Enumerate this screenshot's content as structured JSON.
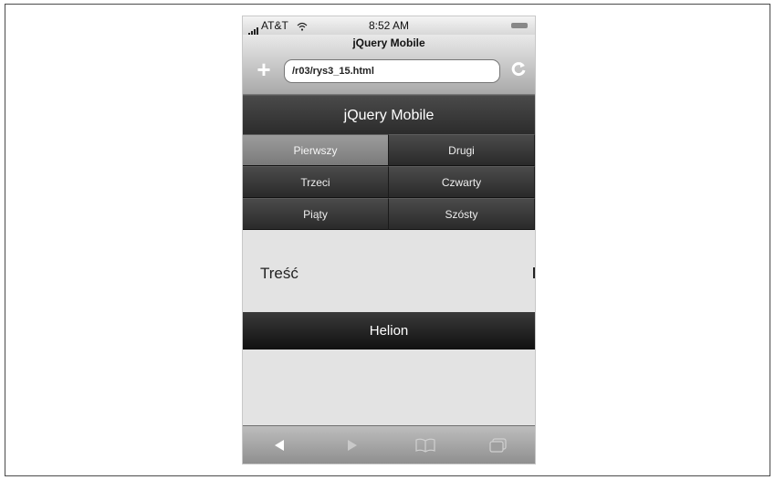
{
  "status_bar": {
    "carrier": "AT&T",
    "time": "8:52 AM"
  },
  "browser": {
    "page_title": "jQuery Mobile",
    "url": "/r03/rys3_15.html"
  },
  "header": {
    "title": "jQuery Mobile"
  },
  "navbar": {
    "items": [
      {
        "label": "Pierwszy",
        "active": true
      },
      {
        "label": "Drugi",
        "active": false
      },
      {
        "label": "Trzeci",
        "active": false
      },
      {
        "label": "Czwarty",
        "active": false
      },
      {
        "label": "Piąty",
        "active": false
      },
      {
        "label": "Szósty",
        "active": false
      }
    ]
  },
  "content": {
    "text": "Treść"
  },
  "footer": {
    "title": "Helion"
  },
  "toolbar": {
    "icons": [
      "back-arrow-icon",
      "forward-arrow-icon",
      "bookmarks-icon",
      "pages-icon"
    ]
  }
}
